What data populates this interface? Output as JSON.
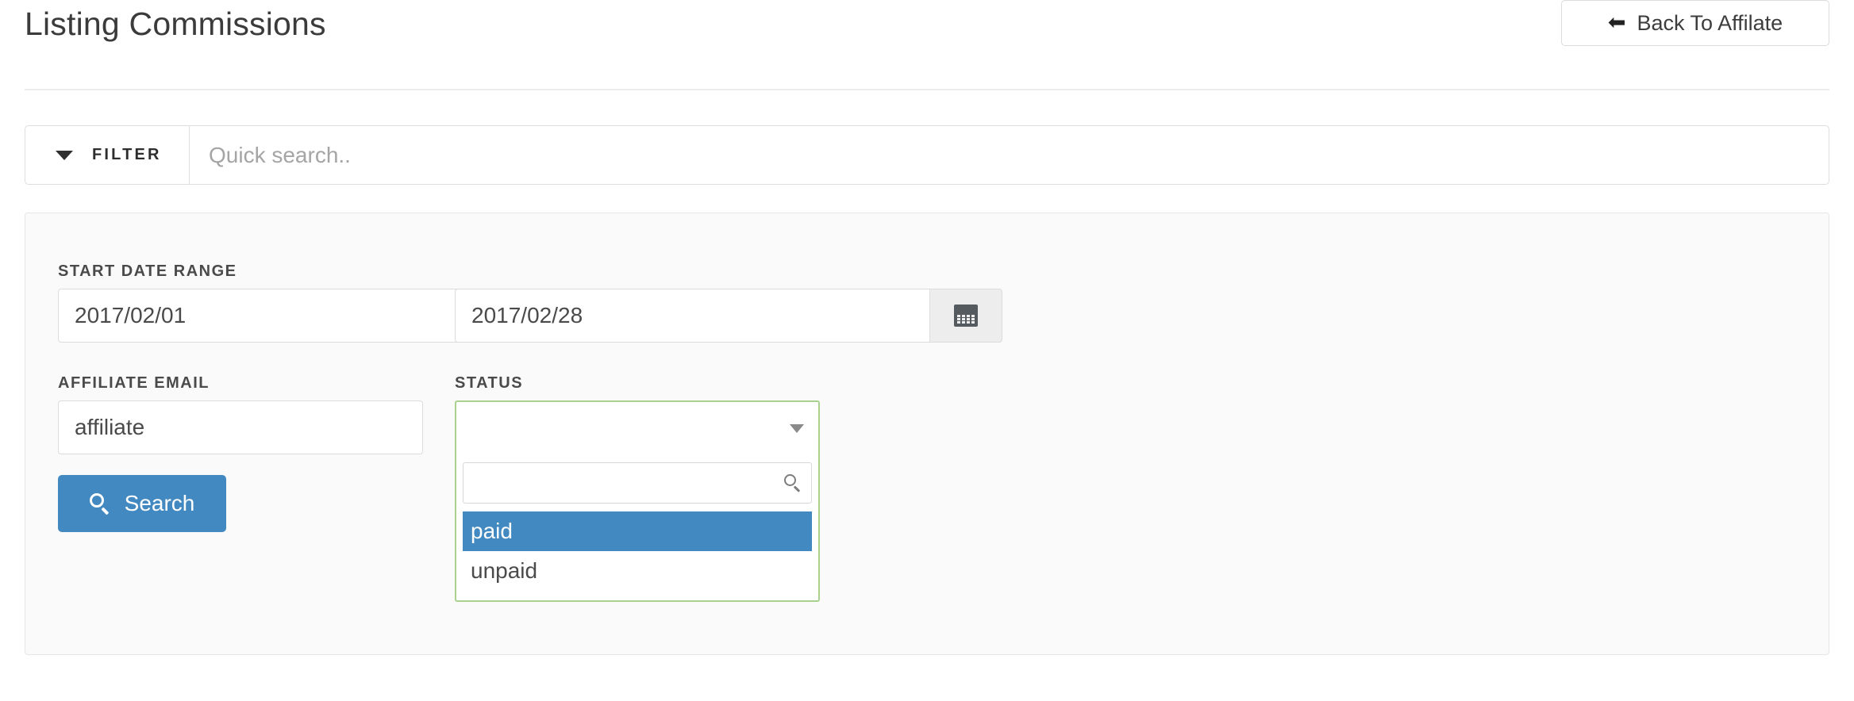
{
  "header": {
    "title": "Listing Commissions",
    "back_button_label": "Back To Affilate",
    "back_icon": "arrow-left-icon"
  },
  "filter_bar": {
    "toggle_label": "FILTER",
    "toggle_icon": "chevron-down-icon",
    "quick_search_placeholder": "Quick search..",
    "quick_search_value": ""
  },
  "filter_panel": {
    "start_date_range": {
      "label": "START DATE RANGE",
      "from_value": "2017/02/01",
      "to_value": "2017/02/28",
      "calendar_icon": "calendar-icon"
    },
    "affiliate_email": {
      "label": "AFFILIATE EMAIL",
      "value": "affiliate",
      "placeholder": ""
    },
    "status": {
      "label": "STATUS",
      "selected_value": "",
      "caret_icon": "caret-down-icon",
      "dropdown": {
        "search_value": "",
        "search_placeholder": "",
        "search_icon": "search-icon",
        "options": [
          {
            "label": "paid",
            "highlighted": true
          },
          {
            "label": "unpaid",
            "highlighted": false
          }
        ]
      }
    },
    "search_button": {
      "label": "Search",
      "icon": "search-icon"
    }
  },
  "colors": {
    "accent_blue": "#4289c1",
    "focus_green": "#aad28f",
    "panel_background": "#fafafa",
    "border_gray": "#dcdcdc",
    "text_dark": "#3b3b3b"
  }
}
